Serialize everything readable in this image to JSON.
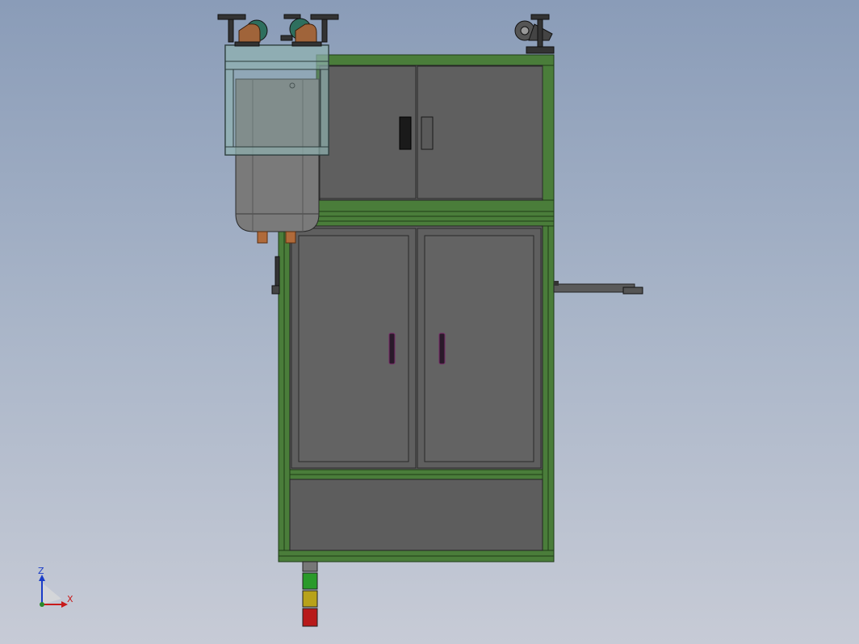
{
  "scene": {
    "background_top": "#8a9cb8",
    "background_bottom": "#c7cbd6",
    "frame_color": "#3c6b2e",
    "panel_color": "#5d5d5d",
    "tank_color": "#7a7a7a",
    "glass_color": "#8fb3b0"
  },
  "axes": {
    "z_label": "Z",
    "x_label": "X",
    "z_color": "#1a3cc8",
    "x_color": "#c81a1a"
  },
  "stack_light": {
    "colors": [
      "#2a9a2a",
      "#b8a21a",
      "#b81a1a"
    ]
  },
  "icons": {
    "caster": "caster-wheel-icon",
    "triad": "axis-triad-icon"
  }
}
